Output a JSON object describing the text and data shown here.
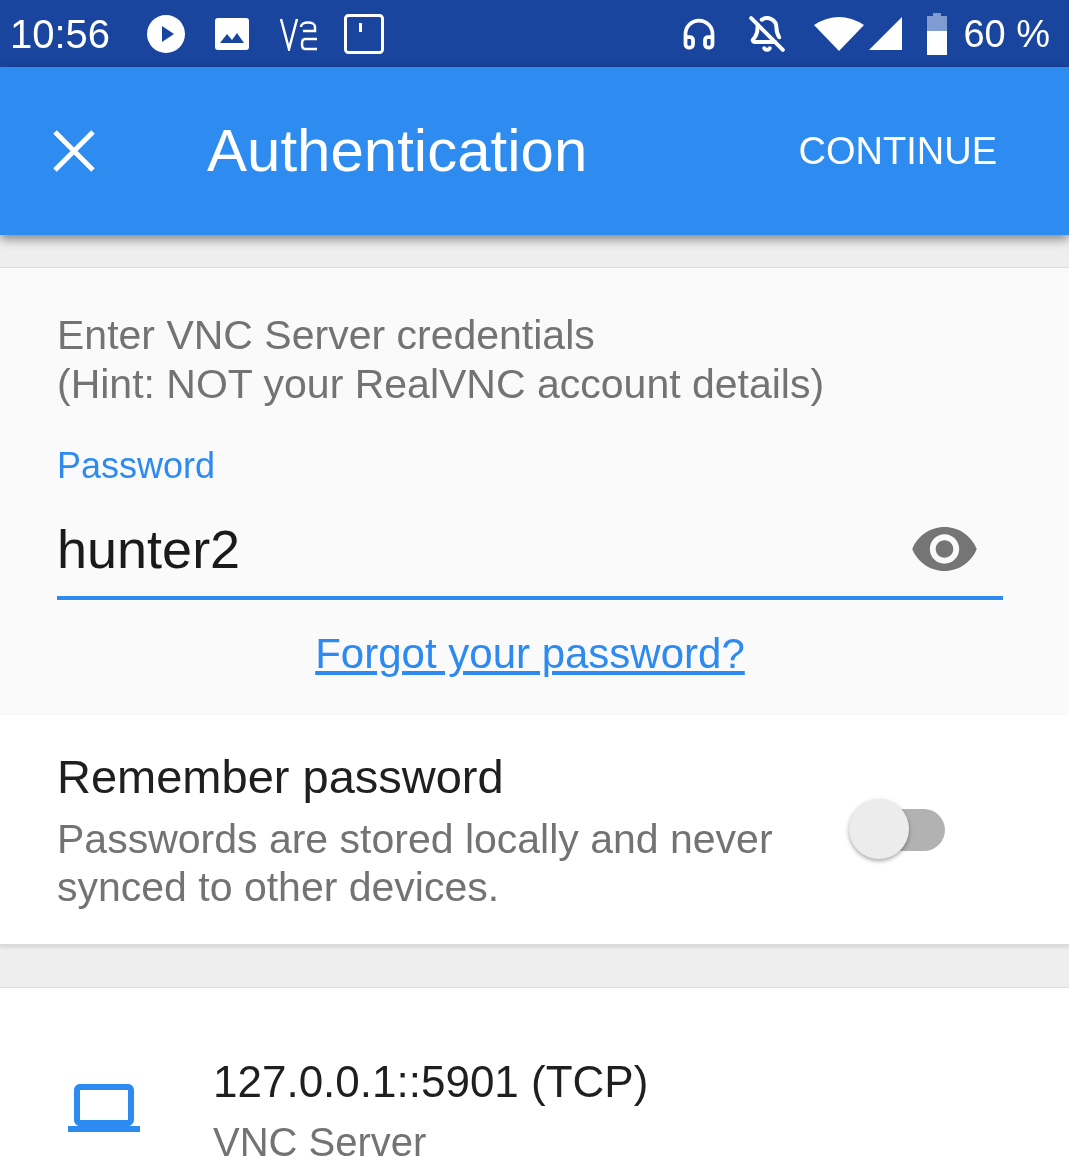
{
  "status_bar": {
    "time": "10:56",
    "battery": "60 %"
  },
  "app_bar": {
    "title": "Authentication",
    "action": "CONTINUE"
  },
  "credentials": {
    "instructions": "Enter VNC Server credentials\n(Hint: NOT your RealVNC account details)",
    "password_field": {
      "label": "Password",
      "value": "hunter2",
      "focused": true
    },
    "forgot_link": "Forgot your password?"
  },
  "remember": {
    "title": "Remember password",
    "description": "Passwords are stored locally and never synced to other devices.",
    "on": false
  },
  "server": {
    "address": "127.0.0.1::5901 (TCP)",
    "name": "VNC Server"
  }
}
